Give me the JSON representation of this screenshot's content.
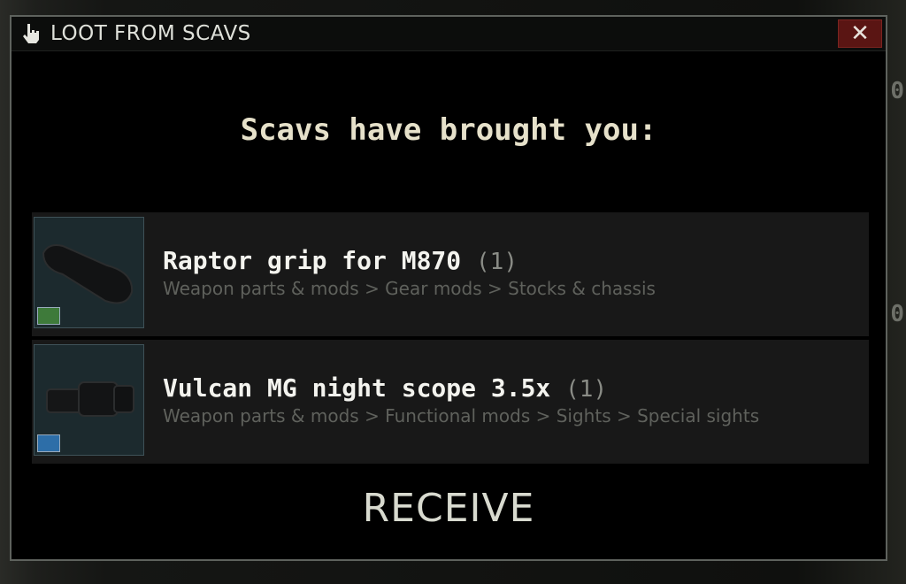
{
  "background": {
    "right_edge_digits": [
      "0",
      "0"
    ]
  },
  "dialog": {
    "title": "LOOT FROM SCAVS",
    "title_icon": "pointing-hand-icon",
    "close_label": "✕",
    "heading": "Scavs have brought you:",
    "items": [
      {
        "name": "Raptor grip for M870",
        "qty": "(1)",
        "path": "Weapon parts & mods > Gear mods > Stocks & chassis",
        "badge": "stock-icon",
        "badge_color": "#3e7a3a"
      },
      {
        "name": "Vulcan MG night scope 3.5x",
        "qty": "(1)",
        "path": "Weapon parts & mods > Functional mods > Sights > Special sights",
        "badge": "scope-reticle-icon",
        "badge_color": "#2d6ea8"
      }
    ],
    "receive_label": "RECEIVE"
  },
  "colors": {
    "dialog_bg": "#000000",
    "close_bg": "#5a1513",
    "heading": "#e6e1ca",
    "path_text": "#5f615c"
  }
}
